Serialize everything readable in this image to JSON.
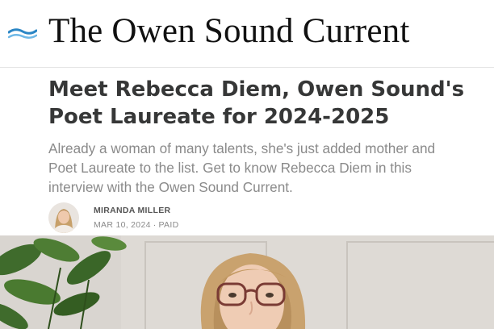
{
  "site": {
    "title": "The Owen Sound Current",
    "logo": "waves-logo-icon",
    "accent_color": "#2b86c5"
  },
  "article": {
    "title": "Meet Rebecca Diem, Owen Sound's Poet Laureate for 2024-2025",
    "subtitle": "Already a woman of many talents, she's just added mother and Poet Laureate to the list. Get to know Rebecca Diem in this interview with the Owen Sound Current.",
    "author": {
      "name": "MIRANDA MILLER",
      "avatar": "author-avatar-photo"
    },
    "date": "MAR 10, 2024",
    "separator": "·",
    "access": "PAID",
    "hero_image": "hero-photo-woman-with-glasses"
  }
}
